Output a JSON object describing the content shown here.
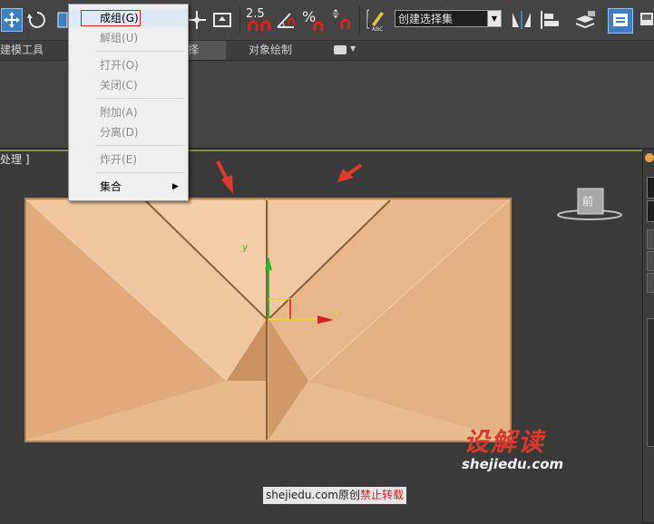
{
  "toolbar": {
    "snap_label": "2.5",
    "percent_label": "%",
    "selection_set_value": "创建选择集"
  },
  "ribbon": {
    "tabs": [
      {
        "label": "建模工具"
      },
      {
        "label": "择"
      },
      {
        "label": "对象绘制"
      }
    ]
  },
  "viewport": {
    "label": "处理 ]",
    "axis_y": "y",
    "axis_x": "x",
    "viewcube_label": "前"
  },
  "menu": {
    "items": [
      {
        "label": "成组(G)",
        "enabled": true
      },
      {
        "label": "解组(U)",
        "enabled": false
      },
      {
        "label": "打开(O)",
        "enabled": false
      },
      {
        "label": "关闭(C)",
        "enabled": false
      },
      {
        "label": "附加(A)",
        "enabled": false
      },
      {
        "label": "分离(D)",
        "enabled": false
      },
      {
        "label": "炸开(E)",
        "enabled": false
      },
      {
        "label": "集合",
        "enabled": true
      }
    ]
  },
  "watermark": {
    "url_cn_part1": "shejiedu.com原创",
    "url_cn_part2": "禁止转载",
    "brand": "设解读",
    "brand_url": "shejiedu.com"
  },
  "colors": {
    "object_fill": "#e5b383",
    "menu_highlight_border": "#e02020",
    "arrow_red": "#e03a2a",
    "active_button": "#3f7fbf"
  }
}
